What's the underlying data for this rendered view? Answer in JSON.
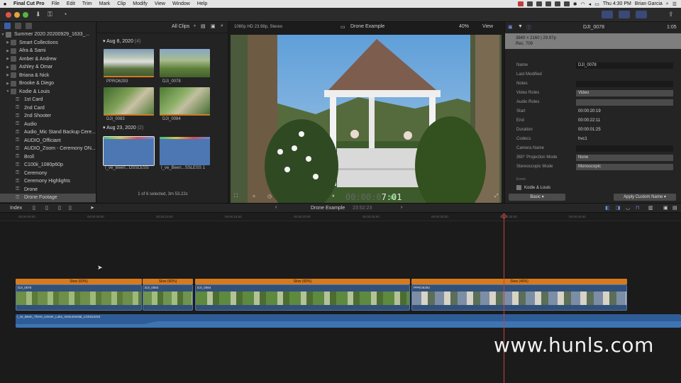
{
  "menubar": {
    "app": "Final Cut Pro",
    "items": [
      "File",
      "Edit",
      "Trim",
      "Mark",
      "Clip",
      "Modify",
      "View",
      "Window",
      "Help"
    ],
    "clock": "Thu 4:30 PM",
    "user": "Brian Garcia"
  },
  "sidebar": {
    "library": "Summer 2020 20200929_1633_...",
    "events": [
      {
        "label": "Smart Collections",
        "kind": "folder"
      },
      {
        "label": "Afra & Sami",
        "kind": "event"
      },
      {
        "label": "Amber & Andrew",
        "kind": "event"
      },
      {
        "label": "Ashley & Omar",
        "kind": "event"
      },
      {
        "label": "Briana & Nick",
        "kind": "event"
      },
      {
        "label": "Brooke & Diego",
        "kind": "event"
      },
      {
        "label": "Kodie & Louis",
        "kind": "event-open"
      }
    ],
    "keywords": [
      "1st Card",
      "2nd Card",
      "2nd Shooter",
      "Audio",
      "Audio_Mic Stand Backup Cere...",
      "AUDIO_Officiant",
      "AUDIO_Zoom - Ceremony ON...",
      "Broll",
      "C100ii_1080p60p",
      "Ceremony",
      "Ceremony Highlights",
      "Drone",
      "Drone Footage"
    ],
    "selected": "Drone Footage"
  },
  "browser": {
    "filter": "All Clips",
    "groups": [
      {
        "date": "Aug 8, 2020",
        "count": "(4)",
        "clips": [
          "PPRO6293",
          "DJI_0078",
          "DJI_0083",
          "DJI_0084"
        ]
      },
      {
        "date": "Aug 23, 2020",
        "count": "(2)",
        "clips": [
          "I_ve_Been...OSSLESS",
          "I_ve_Been...SSLESS 1"
        ]
      }
    ],
    "footer": "1 of 6 selected, 3m 53.22s"
  },
  "viewer": {
    "format": "1080p HD 23.98p, Stereo",
    "title": "Drone Example",
    "zoom": "40%",
    "view": "View",
    "timecode_dim": "00:00:0",
    "timecode": "7:01"
  },
  "inspector": {
    "clip": "DJI_0078",
    "time": "1:05",
    "banner_line1": "3840 × 2160 | 29.97p",
    "banner_line2": "Rec. 709",
    "rows": [
      {
        "label": "Name",
        "value": "DJI_0078",
        "style": "field"
      },
      {
        "label": "Last Modified",
        "value": "",
        "style": "plain"
      },
      {
        "label": "Notes",
        "value": "",
        "style": "field"
      },
      {
        "label": "Video Roles",
        "value": "Video",
        "style": "popup"
      },
      {
        "label": "Audio Roles",
        "value": "",
        "style": "popup"
      },
      {
        "label": "Start",
        "value": "00:00:20:19",
        "style": "plain"
      },
      {
        "label": "End",
        "value": "00:00:22:11",
        "style": "plain"
      },
      {
        "label": "Duration",
        "value": "00:00:01:25",
        "style": "plain"
      },
      {
        "label": "Codecs",
        "value": "hvc1",
        "style": "plain"
      },
      {
        "label": "Camera Name",
        "value": "",
        "style": "field"
      },
      {
        "label": "360° Projection Mode",
        "value": "None",
        "style": "popup"
      },
      {
        "label": "Stereoscopic Mode",
        "value": "Monoscopic",
        "style": "popup"
      }
    ],
    "event_label": "Event",
    "event_value": "Kodie & Louis",
    "metadata_view": "Basic",
    "apply_button": "Apply Custom Name"
  },
  "timeline": {
    "index_label": "Index",
    "project": "Drone Example",
    "duration": "23:52:23",
    "ruler": [
      "00:00:00:00",
      "00:00:05:00",
      "00:00:10:00",
      "00:00:15:00",
      "00:00:20:00",
      "00:00:25:00",
      "00:00:30:00",
      "00:00:35:00",
      "00:00:40:00"
    ],
    "retime": [
      "Slow (60%)",
      "Slow (60%)",
      "Slow (60%)",
      "Slow (40%)"
    ],
    "video_clips": [
      "DJI_0078",
      "DJI_0083",
      "DJI_0084",
      "PPRO6293"
    ],
    "audio_clip": "I_ve_Been_There_Urever_Luke_Instrumental_LOSSLESS"
  },
  "watermark": "www.hunls.com"
}
